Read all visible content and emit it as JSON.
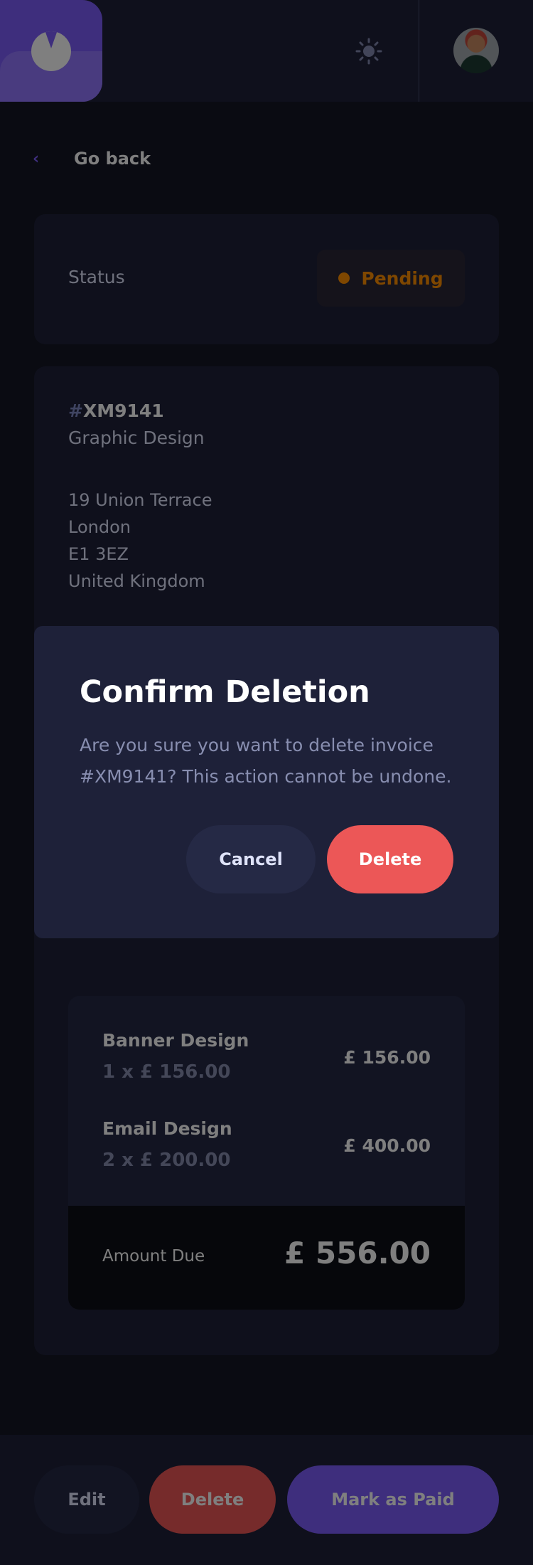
{
  "header": {
    "logo": "invoice-app-logo",
    "theme_toggle_icon": "sun-icon",
    "avatar": "user-avatar"
  },
  "nav": {
    "back_label": "Go back",
    "back_icon": "chevron-left-icon"
  },
  "status": {
    "label": "Status",
    "value": "Pending",
    "color": "#FF8F00"
  },
  "invoice": {
    "id_prefix": "#",
    "id": "XM9141",
    "description": "Graphic Design",
    "sender_address": [
      "19 Union Terrace",
      "London",
      "E1 3EZ",
      "United Kingdom"
    ],
    "items": [
      {
        "name": "Banner Design",
        "qty_price": "1 x £ 156.00",
        "total": "£ 156.00"
      },
      {
        "name": "Email Design",
        "qty_price": "2 x £ 200.00",
        "total": "£ 400.00"
      }
    ],
    "amount_due_label": "Amount Due",
    "amount_due": "£ 556.00"
  },
  "actions": {
    "edit": "Edit",
    "delete": "Delete",
    "mark_paid": "Mark as Paid"
  },
  "modal": {
    "title": "Confirm Deletion",
    "message": "Are you sure you want to delete invoice #XM9141? This action cannot be undone.",
    "cancel": "Cancel",
    "delete": "Delete"
  },
  "colors": {
    "accent": "#7C5DFA",
    "danger": "#EC5757",
    "background": "#141625",
    "surface": "#1E2139"
  }
}
